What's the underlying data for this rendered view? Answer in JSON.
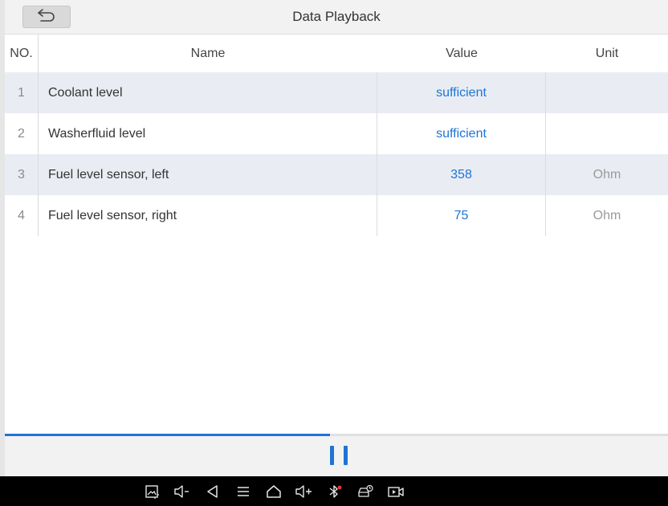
{
  "header": {
    "title": "Data Playback",
    "back_icon": "back-arrow-icon"
  },
  "table": {
    "columns": {
      "no": "NO.",
      "name": "Name",
      "value": "Value",
      "unit": "Unit"
    },
    "rows": [
      {
        "no": "1",
        "name": "Coolant level",
        "value": "sufficient",
        "unit": ""
      },
      {
        "no": "2",
        "name": "Washerfluid level",
        "value": "sufficient",
        "unit": ""
      },
      {
        "no": "3",
        "name": "Fuel level sensor, left",
        "value": "358",
        "unit": "Ohm"
      },
      {
        "no": "4",
        "name": "Fuel level sensor, right",
        "value": "75",
        "unit": "Ohm"
      }
    ]
  },
  "playback": {
    "progress_fraction": 0.49,
    "control_icon": "pause-icon"
  },
  "colors": {
    "accent": "#1e74d6",
    "row_shade": "#e9edf3",
    "bluetooth_dot": "#e53935"
  },
  "system_nav": {
    "icons": [
      "screenshot-icon",
      "volume-down-icon",
      "back-icon",
      "menu-icon",
      "home-icon",
      "volume-up-icon",
      "bluetooth-icon",
      "vehicle-diagnostic-icon",
      "screen-record-icon"
    ]
  }
}
